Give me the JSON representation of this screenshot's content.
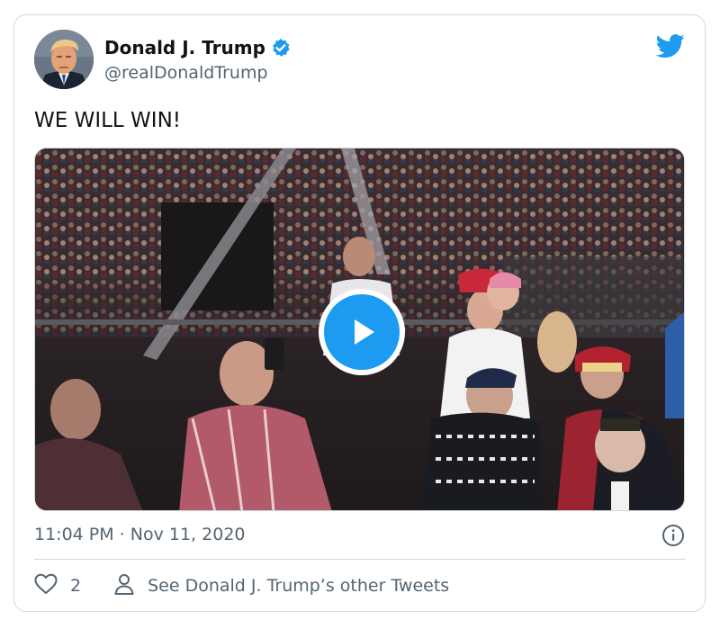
{
  "tweet": {
    "author": {
      "display_name": "Donald J. Trump",
      "handle": "@realDonaldTrump",
      "verified": true
    },
    "text": "WE WILL WIN!",
    "timestamp": "11:04 PM · Nov 11, 2020",
    "likes": "2",
    "other_tweets_label": "See Donald J. Trump’s other Tweets"
  },
  "colors": {
    "brand_blue": "#1d9bf0",
    "secondary_text": "#536471",
    "border": "#cfd9de"
  },
  "icons": {
    "brand": "twitter-bird-icon",
    "verified": "verified-badge-icon",
    "play": "play-icon",
    "info": "info-icon",
    "like": "heart-icon",
    "profile": "person-icon"
  }
}
